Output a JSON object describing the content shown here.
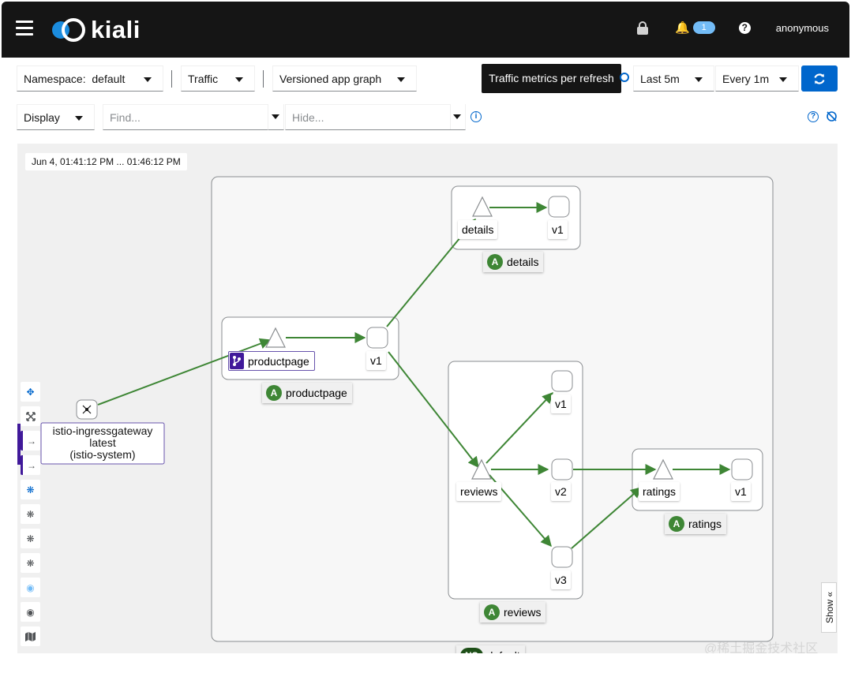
{
  "masthead": {
    "brand": "kiali",
    "notifications_count": "1",
    "help_symbol": "?",
    "user": "anonymous",
    "icons": [
      "hamburger-icon",
      "kiali-logo",
      "lock-icon",
      "bell-icon",
      "help-icon"
    ]
  },
  "toolbar": {
    "namespace_label": "Namespace:",
    "namespace_value": "default",
    "traffic": "Traffic",
    "graph_type": "Versioned app graph",
    "tooltip": "Traffic metrics per refresh",
    "duration": "Last 5m",
    "refresh_interval": "Every 1m",
    "display": "Display",
    "find_placeholder": "Find...",
    "hide_placeholder": "Hide..."
  },
  "graph": {
    "time_range": "Jun 4, 01:41:12 PM ... 01:46:12 PM",
    "show_tab": "Show",
    "namespace_box": "default",
    "namespace_badge": "NS",
    "app_badge": "A",
    "edge_color": "#3e8635",
    "badge_color": "#3e8635",
    "vs_badge_color": "#40199a",
    "apps": [
      {
        "name": "details",
        "service": "details",
        "version": "v1"
      },
      {
        "name": "productpage",
        "service": "productpage",
        "version": "v1"
      },
      {
        "name": "reviews",
        "service": "reviews",
        "versions": [
          "v1",
          "v2",
          "v3"
        ]
      },
      {
        "name": "ratings",
        "service": "ratings",
        "version": "v1"
      }
    ],
    "ingress": {
      "line1": "istio-ingressgateway",
      "line2": "latest",
      "line3": "(istio-system)"
    }
  },
  "watermark": "@稀土掘金技术社区"
}
